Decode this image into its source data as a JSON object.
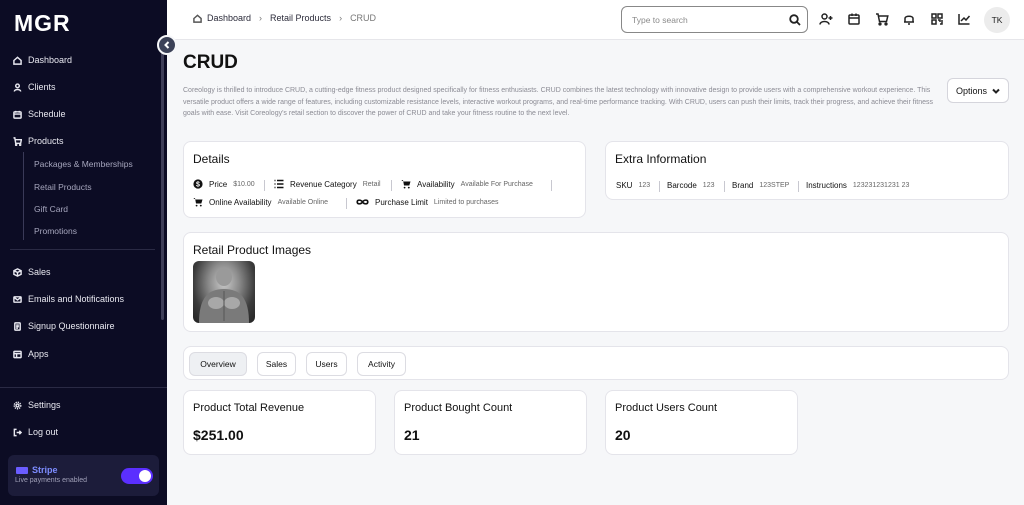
{
  "app": {
    "logo": "MGR"
  },
  "sidebar": {
    "items": [
      {
        "label": "Dashboard"
      },
      {
        "label": "Clients"
      },
      {
        "label": "Schedule"
      },
      {
        "label": "Products"
      }
    ],
    "products_sub": [
      {
        "label": "Packages & Memberships"
      },
      {
        "label": "Retail Products"
      },
      {
        "label": "Gift Card"
      },
      {
        "label": "Promotions"
      }
    ],
    "items2": [
      {
        "label": "Sales"
      },
      {
        "label": "Emails and Notifications"
      },
      {
        "label": "Signup Questionnaire"
      },
      {
        "label": "Apps"
      }
    ],
    "bottom": [
      {
        "label": "Settings"
      },
      {
        "label": "Log out"
      }
    ],
    "stripe": {
      "title": "Stripe",
      "subtitle": "Live payments enabled",
      "enabled": true
    }
  },
  "topbar": {
    "breadcrumbs": [
      "Dashboard",
      "Retail Products",
      "CRUD"
    ],
    "search_placeholder": "Type to search",
    "avatar": "TK"
  },
  "page": {
    "title": "CRUD",
    "description": "Coreology is thrilled to introduce CRUD, a cutting-edge fitness product designed specifically for fitness enthusiasts. CRUD combines the latest technology with innovative design to provide users with a comprehensive workout experience. This versatile product offers a wide range of features, including customizable resistance levels, interactive workout programs, and real-time performance tracking. With CRUD, users can push their limits, track their progress, and achieve their fitness goals with ease. Visit Coreology's retail section to discover the power of CRUD and take your fitness routine to the next level.",
    "options_label": "Options"
  },
  "details": {
    "title": "Details",
    "price_label": "Price",
    "price_value": "$10.00",
    "category_label": "Revenue Category",
    "category_value": "Retail",
    "availability_label": "Availability",
    "availability_value": "Available For Purchase",
    "online_label": "Online Availability",
    "online_value": "Available Online",
    "limit_label": "Purchase Limit",
    "limit_value": "Limited to purchases"
  },
  "extra": {
    "title": "Extra Information",
    "sku_label": "SKU",
    "sku_value": "123",
    "barcode_label": "Barcode",
    "barcode_value": "123",
    "brand_label": "Brand",
    "brand_value": "123STEP",
    "instructions_label": "Instructions",
    "instructions_value": "123231231231 23"
  },
  "images": {
    "title": "Retail Product Images"
  },
  "tabs": [
    {
      "label": "Overview",
      "active": true
    },
    {
      "label": "Sales"
    },
    {
      "label": "Users"
    },
    {
      "label": "Activity"
    }
  ],
  "stats": [
    {
      "title": "Product Total Revenue",
      "value": "$251.00"
    },
    {
      "title": "Product Bought Count",
      "value": "21"
    },
    {
      "title": "Product Users Count",
      "value": "20"
    }
  ]
}
